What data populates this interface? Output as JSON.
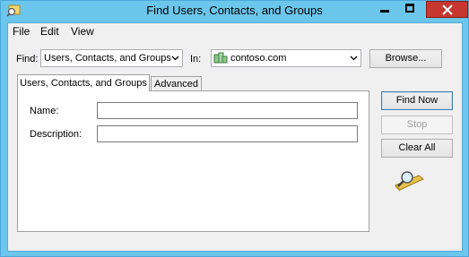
{
  "window": {
    "title": "Find Users, Contacts, and Groups"
  },
  "menu": {
    "items": [
      "File",
      "Edit",
      "View"
    ]
  },
  "find": {
    "label": "Find:",
    "value": "Users, Contacts, and Groups"
  },
  "in": {
    "label": "In:",
    "value": "contoso.com"
  },
  "buttons": {
    "browse": "Browse...",
    "find_now": "Find Now",
    "stop": "Stop",
    "clear_all": "Clear All"
  },
  "tabs": [
    {
      "label": "Users, Contacts, and Groups",
      "active": true
    },
    {
      "label": "Advanced",
      "active": false
    }
  ],
  "fields": {
    "name": {
      "label": "Name:",
      "value": ""
    },
    "description": {
      "label": "Description:",
      "value": ""
    }
  },
  "icons": {
    "app": "find-app-icon",
    "domain": "domain-icon",
    "search_illustration": "magnifier-icon"
  },
  "colors": {
    "titlebar": "#6cc6ec",
    "close": "#c7372f",
    "client": "#f0f0f0"
  }
}
